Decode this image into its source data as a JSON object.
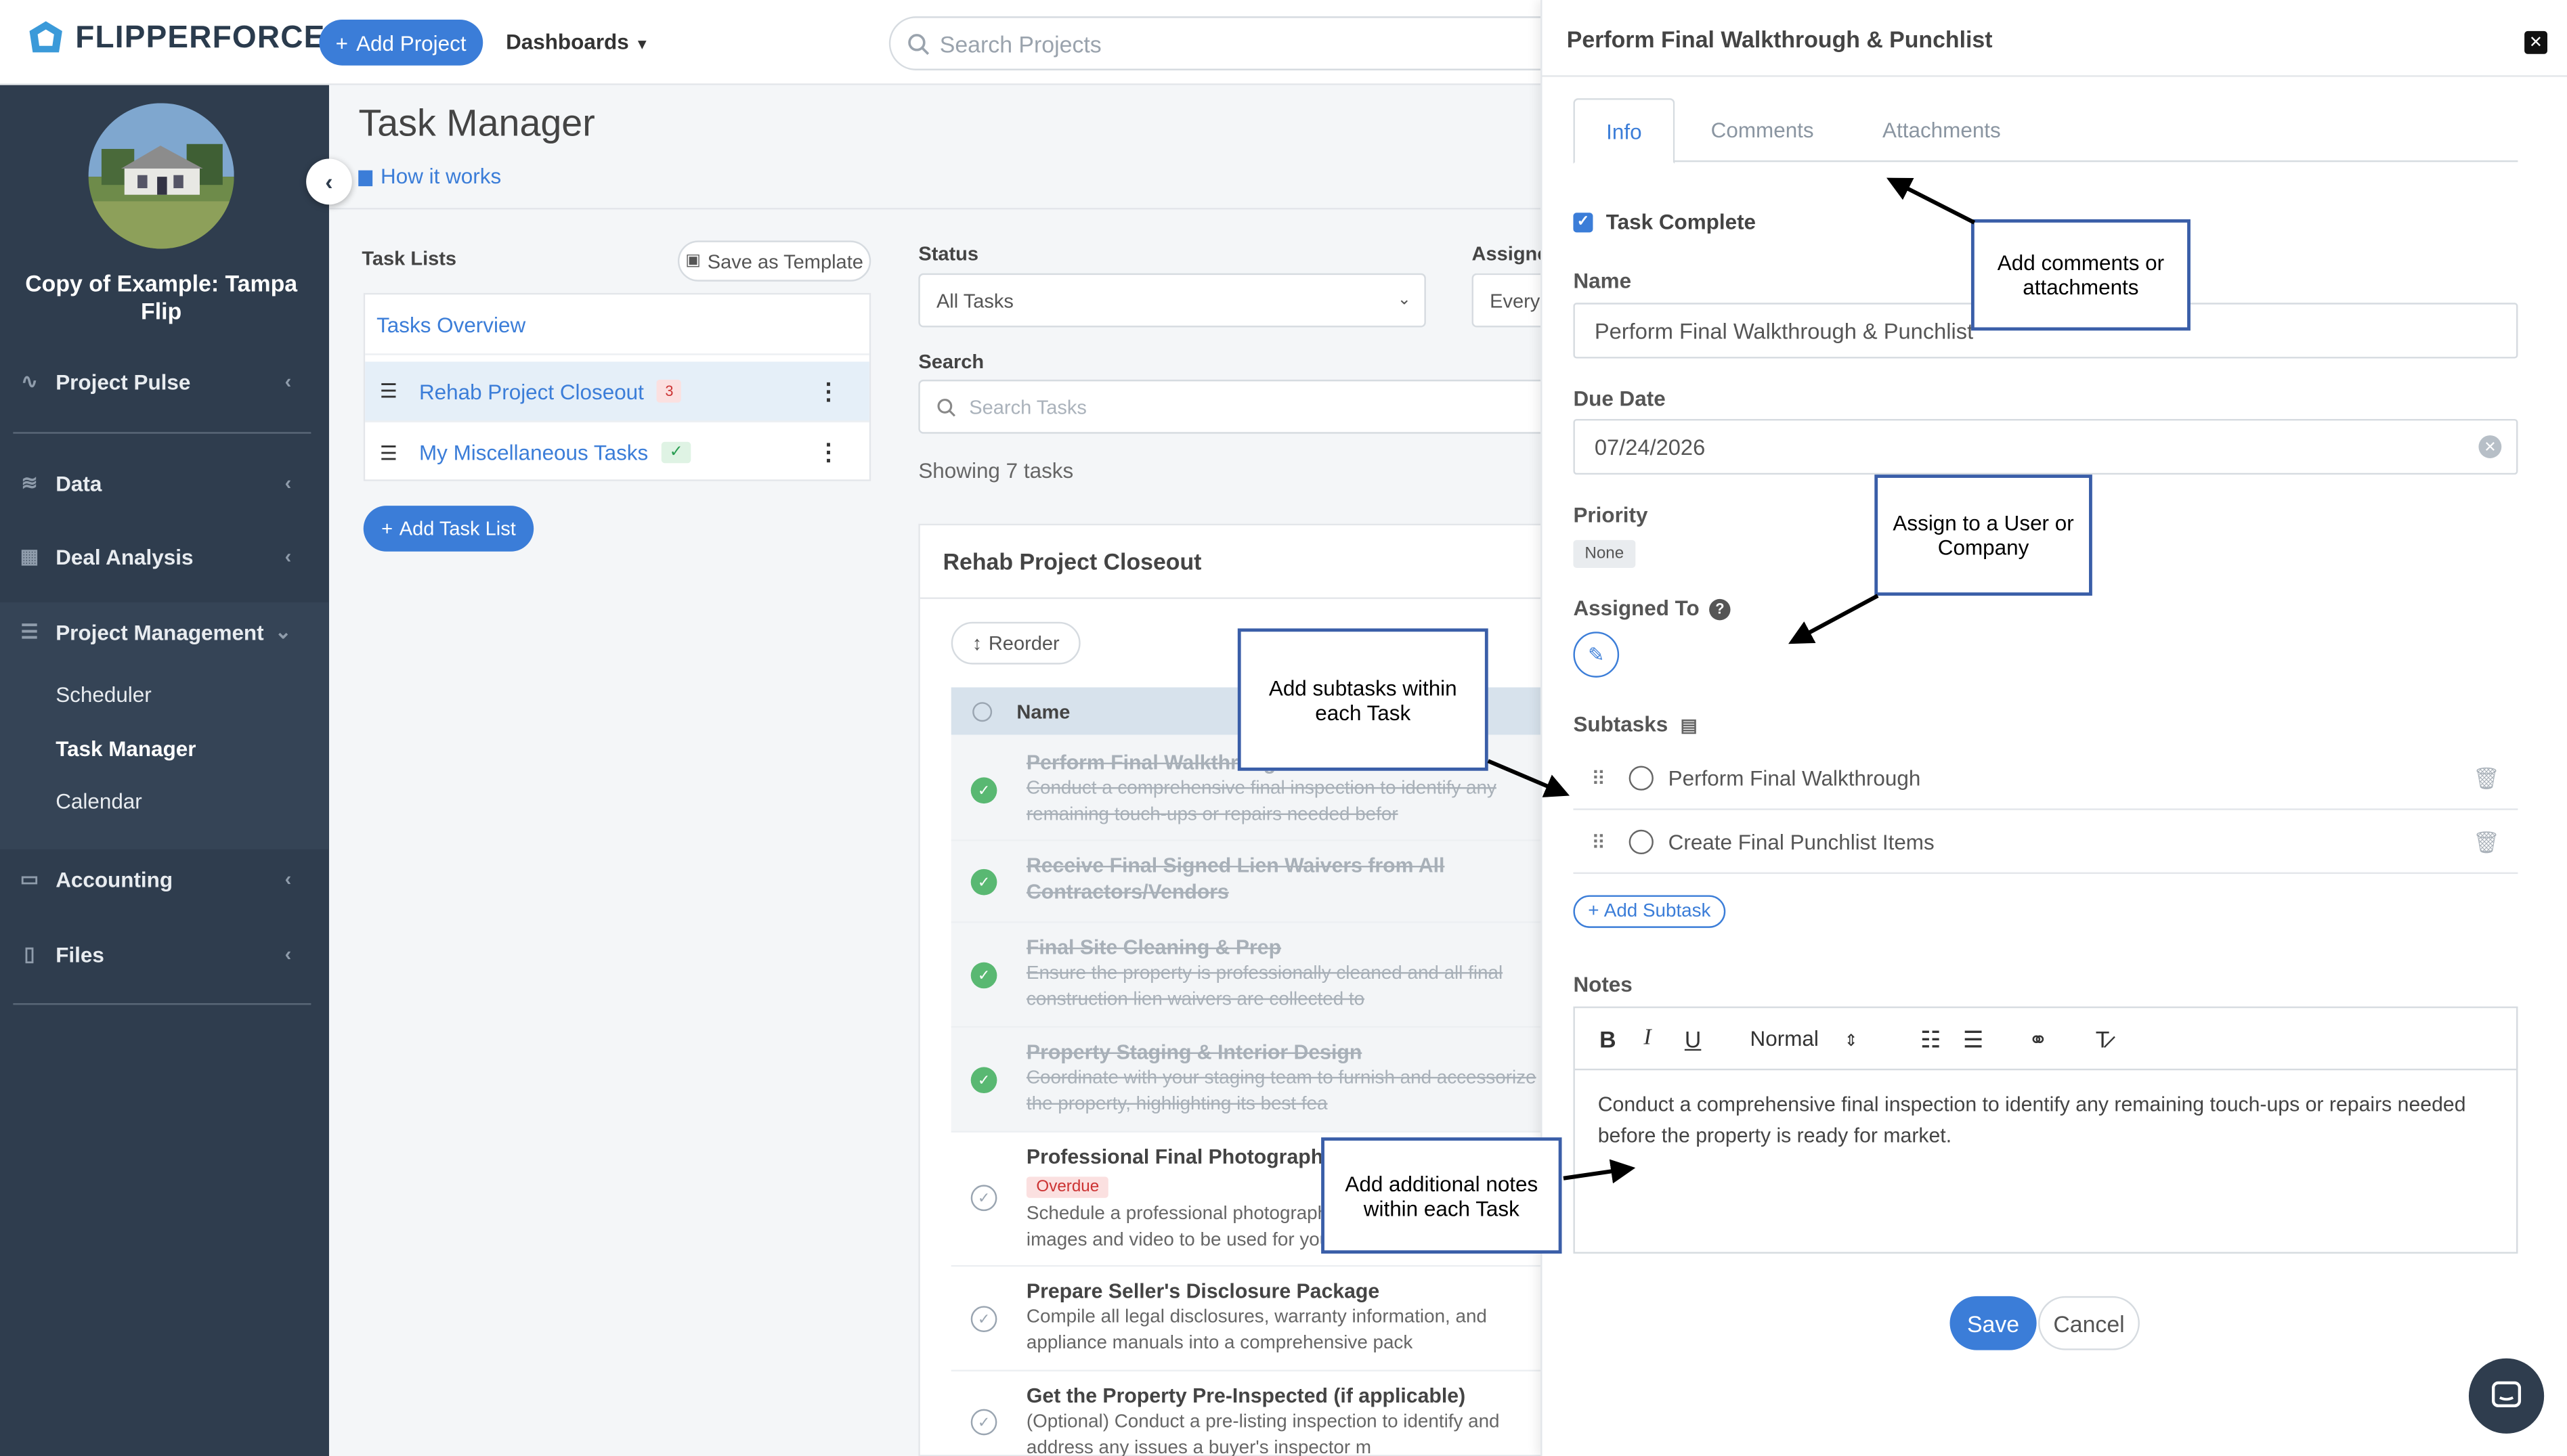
{
  "topbar": {
    "brand": "FLIPPERFORCE",
    "add_project": "Add Project",
    "dashboards": "Dashboards",
    "search_placeholder": "Search Projects"
  },
  "sidebar": {
    "project_name": "Copy of Example: Tampa Flip",
    "items": [
      {
        "label": "Project Pulse",
        "icon": "pulse-icon"
      },
      {
        "label": "Data",
        "icon": "database-icon"
      },
      {
        "label": "Deal Analysis",
        "icon": "calculator-icon"
      },
      {
        "label": "Project Management",
        "icon": "list-icon"
      },
      {
        "label": "Accounting",
        "icon": "money-icon"
      },
      {
        "label": "Files",
        "icon": "file-icon"
      }
    ],
    "sub_items": [
      "Scheduler",
      "Task Manager",
      "Calendar"
    ]
  },
  "main": {
    "title": "Task Manager",
    "how_it_works": "How it works",
    "task_lists_label": "Task Lists",
    "save_as_template": "Save as Template",
    "task_lists": [
      {
        "name": "Tasks Overview"
      },
      {
        "name": "Rehab Project Closeout",
        "badge": "3"
      },
      {
        "name": "My Miscellaneous Tasks",
        "badge": "✓"
      }
    ],
    "add_task_list": "Add Task List",
    "status_label": "Status",
    "status_value": "All Tasks",
    "assignee_label": "Assignee",
    "assignee_value": "Everyone",
    "search_label": "Search",
    "search_placeholder": "Search Tasks",
    "showing": "Showing 7 tasks",
    "card_title": "Rehab Project Closeout",
    "reorder": "Reorder",
    "name_col": "Name",
    "tasks": [
      {
        "name": "Perform Final Walkthrough & Punchlist",
        "desc": "Conduct a comprehensive final inspection to identify any remaining touch-ups or repairs needed befor",
        "done": true
      },
      {
        "name": "Receive Final Signed Lien Waivers from All Contractors/Vendors",
        "desc": "",
        "done": true
      },
      {
        "name": "Final Site Cleaning & Prep",
        "desc": "Ensure the property is professionally cleaned and all final construction lien waivers are collected to",
        "done": true
      },
      {
        "name": "Property Staging & Interior Design",
        "desc": "Coordinate with your staging team to furnish and accessorize the property, highlighting its best fea",
        "done": true
      },
      {
        "name": "Professional Final Photography",
        "status": "Overdue",
        "desc": "Schedule a professional photographer to capture high-quality images and video to be used for your listing",
        "done": false
      },
      {
        "name": "Prepare Seller's Disclosure Package",
        "desc": "Compile all legal disclosures, warranty information, and appliance manuals into a comprehensive pack",
        "done": false
      },
      {
        "name": "Get the Property Pre-Inspected (if applicable)",
        "desc": "(Optional) Conduct a pre-listing inspection to identify and address any issues a buyer's inspector m",
        "done": false
      }
    ]
  },
  "panel": {
    "title": "Perform Final Walkthrough & Punchlist",
    "tabs": [
      "Info",
      "Comments",
      "Attachments"
    ],
    "task_complete": "Task Complete",
    "name_label": "Name",
    "name_value": "Perform Final Walkthrough & Punchlist",
    "due_date_label": "Due Date",
    "due_date_value": "07/24/2026",
    "priority_label": "Priority",
    "priority_value": "None",
    "assigned_label": "Assigned To",
    "subtasks_label": "Subtasks",
    "subtasks": [
      "Perform Final Walkthrough",
      "Create Final Punchlist Items"
    ],
    "add_subtask": "Add Subtask",
    "notes_label": "Notes",
    "format_value": "Normal",
    "notes_text": "Conduct a comprehensive final inspection to identify any remaining touch-ups or repairs needed before the property is ready for market.",
    "save": "Save",
    "cancel": "Cancel"
  },
  "callouts": {
    "comments": "Add comments or attachments",
    "assign": "Assign to a User or Company",
    "subtasks": "Add subtasks within each Task",
    "notes": "Add additional notes within each Task"
  },
  "colors": {
    "accent": "#3b7dd8",
    "sidebar": "#2f3d4e",
    "done": "#59b872",
    "overdue": "#c33333"
  }
}
